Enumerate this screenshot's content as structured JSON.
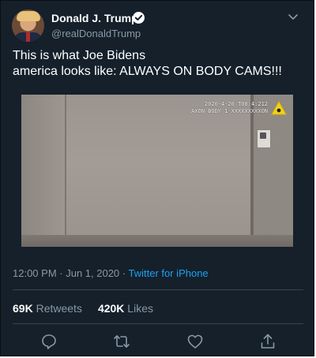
{
  "author": {
    "name": "Donald J. Trump",
    "handle": "@realDonaldTrump",
    "verified": true
  },
  "tweet": {
    "text": "This is what Joe Bidens\namerica looks like: ALWAYS ON BODY CAMS!!!"
  },
  "video_overlay": {
    "line1": "2020-4-20 T08:4:212",
    "line2": "AXON BODY 1 XXXXXXXXXON"
  },
  "meta": {
    "time": "12:00 PM",
    "separator": " · ",
    "date": "Jun 1, 2020",
    "source": "Twitter for iPhone"
  },
  "stats": {
    "retweets_count": "69K",
    "retweets_label": "Retweets",
    "likes_count": "420K",
    "likes_label": "Likes"
  },
  "icons": {
    "reply": "reply-icon",
    "retweet": "retweet-icon",
    "like": "heart-icon",
    "share": "share-icon",
    "menu": "chevron-down-icon"
  },
  "colors": {
    "background": "#15202b",
    "accent": "#1da1f2",
    "secondary_text": "#8899a6",
    "divider": "#38444d"
  }
}
